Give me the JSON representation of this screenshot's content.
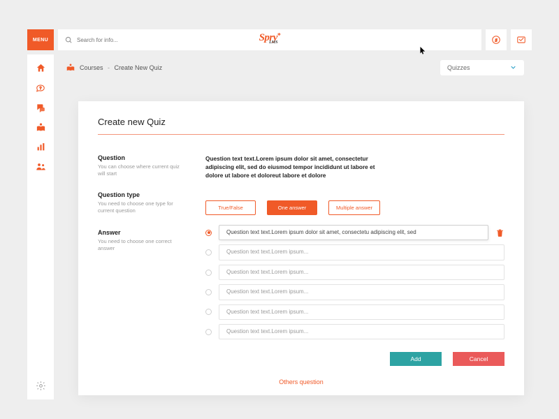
{
  "brand": {
    "main": "Spry",
    "sub": "LMS"
  },
  "menu_label": "MENU",
  "search": {
    "placeholder": "Search for info..."
  },
  "sidebar": {
    "items": [
      "home",
      "help",
      "chat",
      "courses",
      "stats",
      "users",
      "settings"
    ]
  },
  "breadcrumb": {
    "root": "Courses",
    "current": "Create New Quiz"
  },
  "dropdown": {
    "selected": "Quizzes"
  },
  "panel": {
    "title": "Create new Quiz",
    "question_label": "Question",
    "question_hint": "You can choose where current quiz will start",
    "question_text": "Question text text.Lorem ipsum dolor sit amet, consectetur adipiscing elit, sed do eiusmod tempor incididunt ut labore et dolore ut labore et doloreut labore et dolore",
    "type_label": "Question type",
    "type_hint": "You need to choose one type for current question",
    "types": [
      "True/False",
      "One answer",
      "Multiple answer"
    ],
    "type_selected": 1,
    "answer_label": "Answer",
    "answer_hint": "You need to choose one correct answer",
    "answers": [
      {
        "text": "Question text text.Lorem ipsum dolor sit amet, consectetu adipiscing elit, sed",
        "selected": true
      },
      {
        "text": "Question text text.Lorem ipsum...",
        "selected": false
      },
      {
        "text": "Question text text.Lorem ipsum...",
        "selected": false
      },
      {
        "text": "Question text text.Lorem ipsum...",
        "selected": false
      },
      {
        "text": "Question text text.Lorem ipsum...",
        "selected": false
      },
      {
        "text": "Question text text.Lorem ipsum...",
        "selected": false
      }
    ],
    "others_link": "Others question",
    "add_label": "Add",
    "cancel_label": "Cancel"
  }
}
